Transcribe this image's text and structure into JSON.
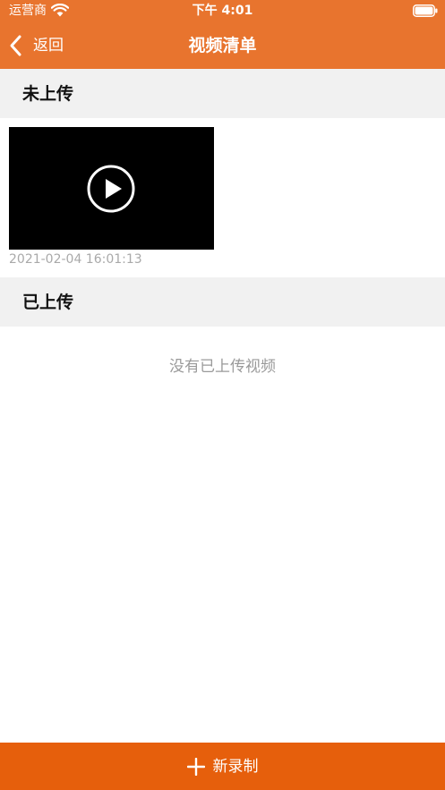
{
  "status_bar": {
    "carrier": "运营商",
    "time": "下午 4:01",
    "wifi_icon": "wifi-icon",
    "battery_icon": "battery-icon"
  },
  "nav": {
    "back_label": "返回",
    "back_icon": "chevron-left-icon",
    "title": "视频清单"
  },
  "sections": {
    "not_uploaded": {
      "title": "未上传",
      "videos": [
        {
          "timestamp": "2021-02-04 16:01:13",
          "icon": "play-icon"
        }
      ]
    },
    "uploaded": {
      "title": "已上传",
      "empty_message": "没有已上传视频"
    }
  },
  "bottom": {
    "record_label": "新录制",
    "icon": "plus-icon"
  },
  "colors": {
    "header": "#E8742E",
    "bottom_bar": "#E65F0C",
    "section_header_bg": "#F1F1F1",
    "timestamp_text": "#A9A9A9",
    "empty_text": "#9A9A9A"
  }
}
